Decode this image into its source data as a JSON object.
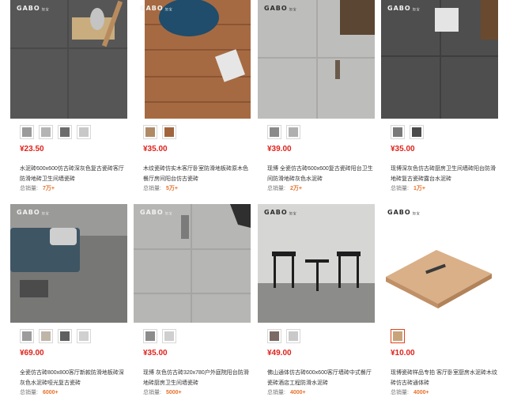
{
  "brand_logo": "GABO",
  "brand_logo_sub": "加宝",
  "sales_label": "总销量:",
  "products": [
    {
      "price": "¥23.50",
      "title": "水泥砖600x600仿古砖深灰色复古瓷砖客厅防滑地砖卫生间墙瓷砖",
      "sales": "7万+",
      "swatches": [
        "#9a9a9a",
        "#b4b4b4",
        "#6c6c6c",
        "#c8c8c8"
      ],
      "active": -1
    },
    {
      "price": "¥35.00",
      "title": "木纹瓷砖仿实木客厅卧室防滑地板砖原木色餐厅房间阳台仿古瓷砖",
      "sales": "5万+",
      "swatches": [
        "#b08a66",
        "#a2643d"
      ],
      "active": -1
    },
    {
      "price": "¥39.00",
      "title": "现博 全瓷仿古砖600x600复古瓷砖阳台卫生间防滑地砖灰色水泥砖",
      "sales": "2万+",
      "swatches": [
        "#8a8a8a",
        "#b0b0b0"
      ],
      "active": -1
    },
    {
      "price": "¥35.00",
      "title": "现博深灰色仿古砖厨房卫生间墙砖阳台防滑地砖复古瓷砖露台水泥砖",
      "sales": "1万+",
      "swatches": [
        "#7a7a7a",
        "#4a4a4a"
      ],
      "active": -1
    },
    {
      "price": "¥69.00",
      "title": "全瓷仿古砖800x800客厅新款防滑地板砖深灰色水泥砖哑光复古瓷砖",
      "sales": "6000+",
      "swatches": [
        "#9c9c9c",
        "#bfb6a8",
        "#5f5f5f",
        "#d0d0d0"
      ],
      "active": -1
    },
    {
      "price": "¥35.00",
      "title": "现博 灰色仿古砖320x780户外庭院阳台防滑地砖厨房卫生间墙瓷砖",
      "sales": "5000+",
      "swatches": [
        "#8c8c8c",
        "#cfcfcf"
      ],
      "active": -1
    },
    {
      "price": "¥49.00",
      "title": "佛山通体仿古砖600x600客厅墙砖中式餐厅瓷砖酒店工程防滑水泥砖",
      "sales": "4000+",
      "swatches": [
        "#7b6a66",
        "#c9c9c9"
      ],
      "active": -1
    },
    {
      "price": "¥10.00",
      "title": "现博瓷砖样品专拍 客厅卧室厨房水泥砖木纹砖仿古砖通体砖",
      "sales": "4000+",
      "swatches": [
        "#c9a37a"
      ],
      "active": 0
    }
  ]
}
